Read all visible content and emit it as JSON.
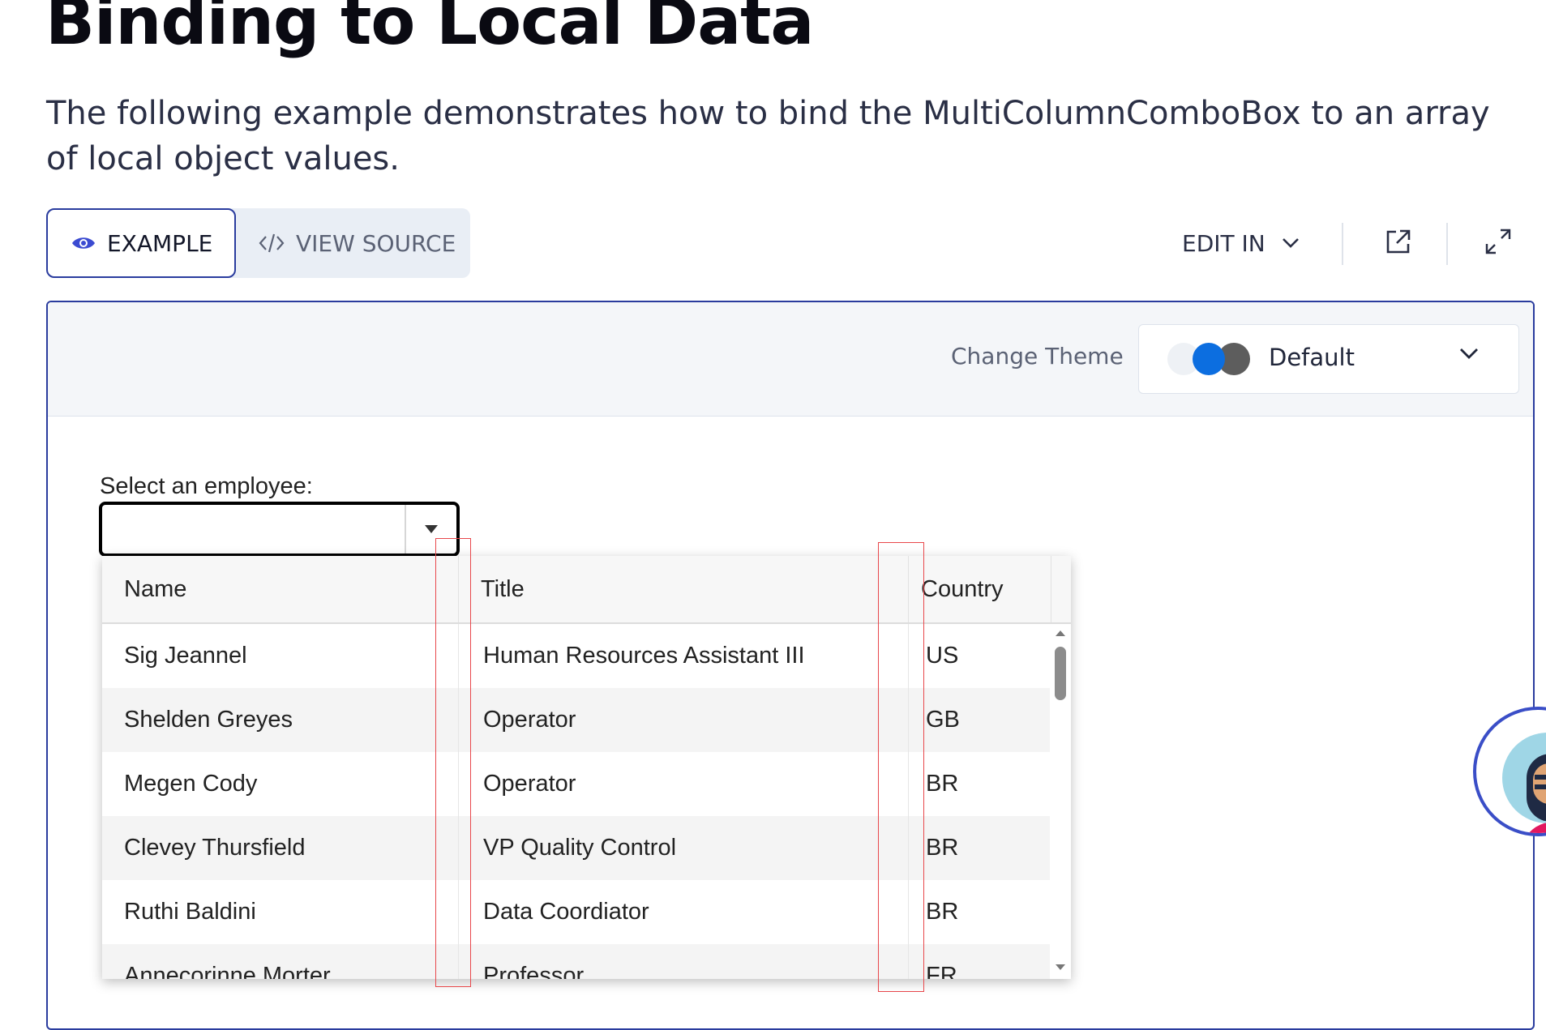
{
  "page": {
    "title": "Binding to Local Data",
    "intro": "The following example demonstrates how to bind the MultiColumnComboBox to an array of local object values."
  },
  "tabs": {
    "example": "EXAMPLE",
    "view_source": "VIEW SOURCE"
  },
  "toolbar": {
    "edit_in": "EDIT IN"
  },
  "theme": {
    "label": "Change Theme",
    "value": "Default"
  },
  "combo": {
    "label": "Select an employee:",
    "value": ""
  },
  "grid": {
    "columns": [
      "Name",
      "Title",
      "Country"
    ],
    "rows": [
      [
        "Sig Jeannel",
        "Human Resources Assistant III",
        "US"
      ],
      [
        "Shelden Greyes",
        "Operator",
        "GB"
      ],
      [
        "Megen Cody",
        "Operator",
        "BR"
      ],
      [
        "Clevey Thursfield",
        "VP Quality Control",
        "BR"
      ],
      [
        "Ruthi Baldini",
        "Data Coordiator",
        "BR"
      ],
      [
        "Annecorinne Morter",
        "Professor",
        "FR"
      ]
    ]
  },
  "colors": {
    "accent": "#2a3c9e",
    "theme_swatch_primary": "#0c6ee0",
    "highlight_marker": "#e8474b"
  },
  "icons": [
    "eye-icon",
    "code-icon",
    "chevron-down-icon",
    "external-link-icon",
    "expand-icon",
    "caret-down-icon",
    "scroll-up-arrow-icon",
    "scroll-down-arrow-icon",
    "chat-avatar-icon"
  ]
}
